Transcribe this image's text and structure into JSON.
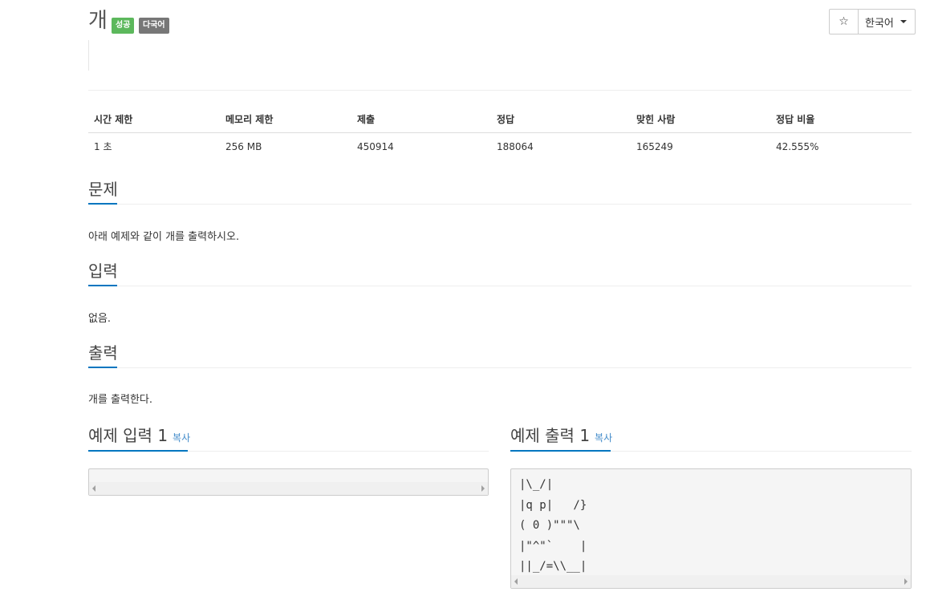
{
  "problem": {
    "title": "개",
    "badges": {
      "success": "성공",
      "multilang": "다국어"
    }
  },
  "toolbar": {
    "star_glyph": "☆",
    "language": "한국어"
  },
  "info_table": {
    "headers": [
      "시간 제한",
      "메모리 제한",
      "제출",
      "정답",
      "맞힌 사람",
      "정답 비율"
    ],
    "values": [
      "1 초",
      "256 MB",
      "450914",
      "188064",
      "165249",
      "42.555%"
    ]
  },
  "sections": {
    "description": {
      "heading": "문제",
      "text": "아래 예제와 같이 개를 출력하시오."
    },
    "input": {
      "heading": "입력",
      "text": "없음."
    },
    "output": {
      "heading": "출력",
      "text": "개를 출력한다."
    }
  },
  "samples": {
    "input": {
      "heading": "예제 입력 1",
      "copy": "복사",
      "content": ""
    },
    "output": {
      "heading": "예제 출력 1",
      "copy": "복사",
      "lines": [
        "|\\_/|",
        "|q p|   /}",
        "( 0 )\"\"\"\\",
        "|\"^\"`    |",
        "||_/=\\\\__|"
      ]
    }
  },
  "colors": {
    "accent": "#0076c0",
    "success_badge": "#5cb85c",
    "multilang_badge": "#777777",
    "link": "#428bca"
  }
}
